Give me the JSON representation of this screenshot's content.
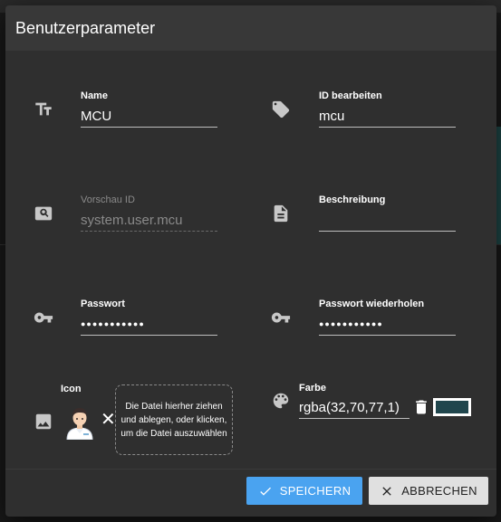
{
  "dialog": {
    "title": "Benutzerparameter"
  },
  "fields": {
    "name": {
      "label": "Name",
      "value": "MCU",
      "icon": "text-format-icon"
    },
    "id_edit": {
      "label": "ID bearbeiten",
      "value": "mcu",
      "icon": "tag-icon"
    },
    "preview_id": {
      "label": "Vorschau ID",
      "value": "system.user.mcu",
      "icon": "image-search-icon"
    },
    "description": {
      "label": "Beschreibung",
      "value": "",
      "icon": "document-icon"
    },
    "password": {
      "label": "Passwort",
      "value": "●●●●●●●●●●●",
      "icon": "key-icon"
    },
    "password_repeat": {
      "label": "Passwort wiederholen",
      "value": "●●●●●●●●●●●",
      "icon": "key-icon"
    },
    "icon": {
      "label": "Icon",
      "icon": "image-icon",
      "dropzone_text": "Die Datei hierher ziehen und ablegen, oder klicken, um die Datei auszuwählen"
    },
    "color": {
      "label": "Farbe",
      "value": "rgba(32,70,77,1)",
      "icon": "palette-icon",
      "swatch": "#20464d"
    }
  },
  "buttons": {
    "save": "SPEICHERN",
    "cancel": "ABBRECHEN"
  },
  "colors": {
    "accent": "#4aa3f0",
    "dialog_bg": "#2f2f2f",
    "header_bg": "#383838"
  }
}
